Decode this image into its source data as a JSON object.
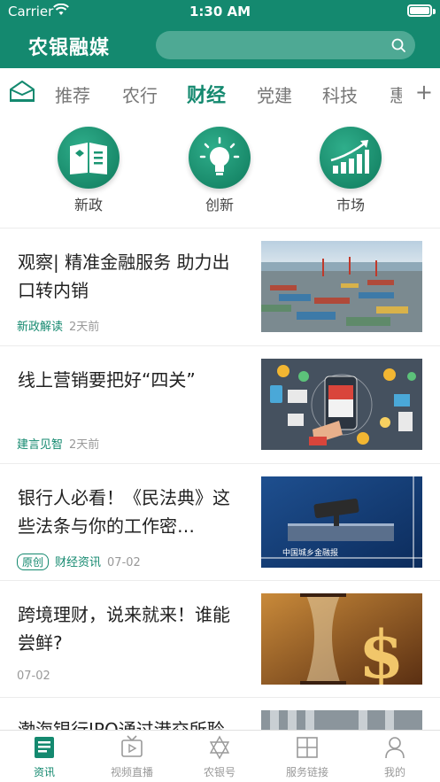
{
  "status_bar": {
    "carrier": "Carrier",
    "time": "1:30 AM"
  },
  "header": {
    "title": "农银融媒",
    "search_placeholder": ""
  },
  "tabs": [
    {
      "label": "推荐",
      "active": false
    },
    {
      "label": "农行",
      "active": false
    },
    {
      "label": "财经",
      "active": true
    },
    {
      "label": "党建",
      "active": false
    },
    {
      "label": "科技",
      "active": false
    },
    {
      "label": "惠",
      "active": false
    }
  ],
  "categories": [
    {
      "label": "新政",
      "icon": "newspaper-icon"
    },
    {
      "label": "创新",
      "icon": "lightbulb-icon"
    },
    {
      "label": "市场",
      "icon": "growth-chart-icon"
    }
  ],
  "articles": [
    {
      "title": "观察| 精准金融服务  助力出口转内销",
      "badge": "",
      "source": "新政解读",
      "time": "2天前",
      "thumb": "container-port"
    },
    {
      "title": "线上营销要把好“四关”",
      "badge": "",
      "source": "建言见智",
      "time": "2天前",
      "thumb": "online-shop-illustration"
    },
    {
      "title": "银行人必看！《民法典》这些法条与你的工作密…",
      "badge": "原创",
      "source": "财经资讯",
      "time": "07-02",
      "thumb": "gavel",
      "thumb_caption": "中国城乡金融报"
    },
    {
      "title": "跨境理财，说来就来！谁能尝鲜?",
      "badge": "",
      "source": "",
      "time": "07-02",
      "thumb": "hourglass-dollar"
    },
    {
      "title": "渤海银行IPO通过港交所聆",
      "badge": "",
      "source": "",
      "time": "",
      "thumb": "building"
    }
  ],
  "tabbar": [
    {
      "label": "资讯",
      "active": true,
      "icon": "news-icon"
    },
    {
      "label": "视频直播",
      "active": false,
      "icon": "tv-icon"
    },
    {
      "label": "农银号",
      "active": false,
      "icon": "star-badge-icon"
    },
    {
      "label": "服务链接",
      "active": false,
      "icon": "grid-icon"
    },
    {
      "label": "我的",
      "active": false,
      "icon": "user-icon"
    }
  ],
  "colors": {
    "brand": "#14896f",
    "inactive_text": "#777777"
  }
}
